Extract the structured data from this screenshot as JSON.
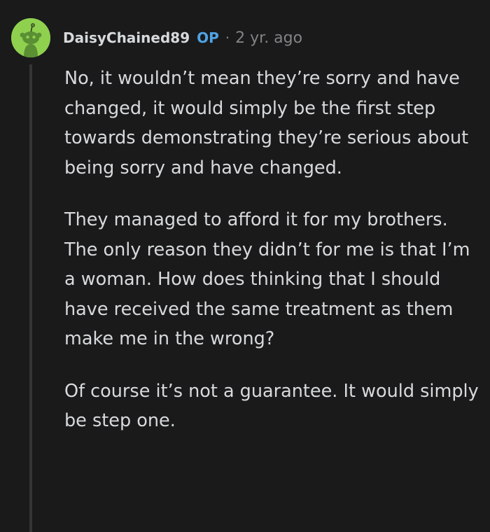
{
  "comment": {
    "username": "DaisyChained89",
    "badge": "OP",
    "separator": "·",
    "timestamp": "2 yr. ago",
    "avatar_icon": "reddit-snoo-avatar-icon",
    "colors": {
      "background": "#1a1a1b",
      "text": "#d7dadc",
      "muted": "#818384",
      "op_badge": "#4fa3e3",
      "avatar_bg": "#8fd14f",
      "thread_line": "#343536"
    },
    "paragraphs": [
      "No, it wouldn’t mean they’re sorry and have changed, it would simply be the first step towards demonstrating they’re serious about being sorry and have changed.",
      "They managed to afford it for my brothers. The only reason they didn’t for me is that I’m a woman. How does thinking that I should have received the same treatment as them make me in the wrong?",
      "Of course it’s not a guarantee. It would simply be step one."
    ]
  }
}
